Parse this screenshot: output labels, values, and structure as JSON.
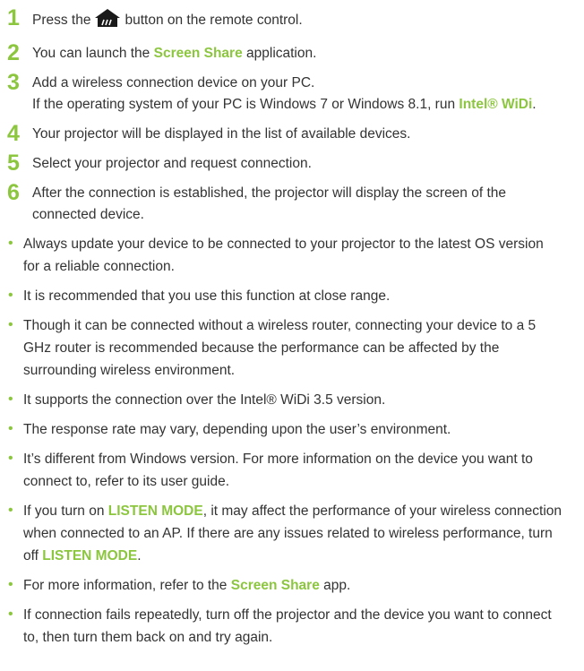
{
  "colors": {
    "accent": "#8cc63f",
    "text": "#333333"
  },
  "icons": {
    "home": "home-icon"
  },
  "steps": [
    {
      "num": "1",
      "a": "Press the",
      "b": "button on the remote control."
    },
    {
      "num": "2",
      "a": "You can launch the ",
      "hl": "Screen Share",
      "b": " application."
    },
    {
      "num": "3",
      "line1": "Add a wireless connection device on your PC.",
      "a": "If the operating system of your PC is Windows 7 or Windows 8.1, run ",
      "hl": "Intel® WiDi",
      "b": "."
    },
    {
      "num": "4",
      "text": "Your projector will be displayed in the list of available devices."
    },
    {
      "num": "5",
      "text": "Select your projector and request connection."
    },
    {
      "num": "6",
      "text": "After the connection is established, the projector will display the screen of the connected device."
    }
  ],
  "notes": [
    {
      "text": "Always update your device to be connected to your projector to the latest OS version for a reliable connection."
    },
    {
      "text": "It is recommended that you use this function at close range."
    },
    {
      "text": "Though it can be connected without a wireless router, connecting your device to a 5 GHz router is recommended because the performance can be affected by the surrounding wireless environment."
    },
    {
      "text": "It supports the connection over the Intel® WiDi 3.5 version."
    },
    {
      "text": "The response rate may vary, depending upon the user’s environment."
    },
    {
      "text": "It’s different from Windows version. For more information on the device you want to connect to, refer to its user guide."
    },
    {
      "a": "If you turn on ",
      "hl1": "LISTEN MODE",
      "b": ", it may affect the performance of your wireless connection when connected to an AP. If there are any issues related to wireless performance, turn off ",
      "hl2": "LISTEN MODE",
      "c": "."
    },
    {
      "a": "For more information, refer to the ",
      "hl1": "Screen Share",
      "b": " app."
    },
    {
      "text": "If connection fails repeatedly, turn off the projector and the device you want to connect to, then turn them back on and try again."
    }
  ],
  "bullet": "•"
}
